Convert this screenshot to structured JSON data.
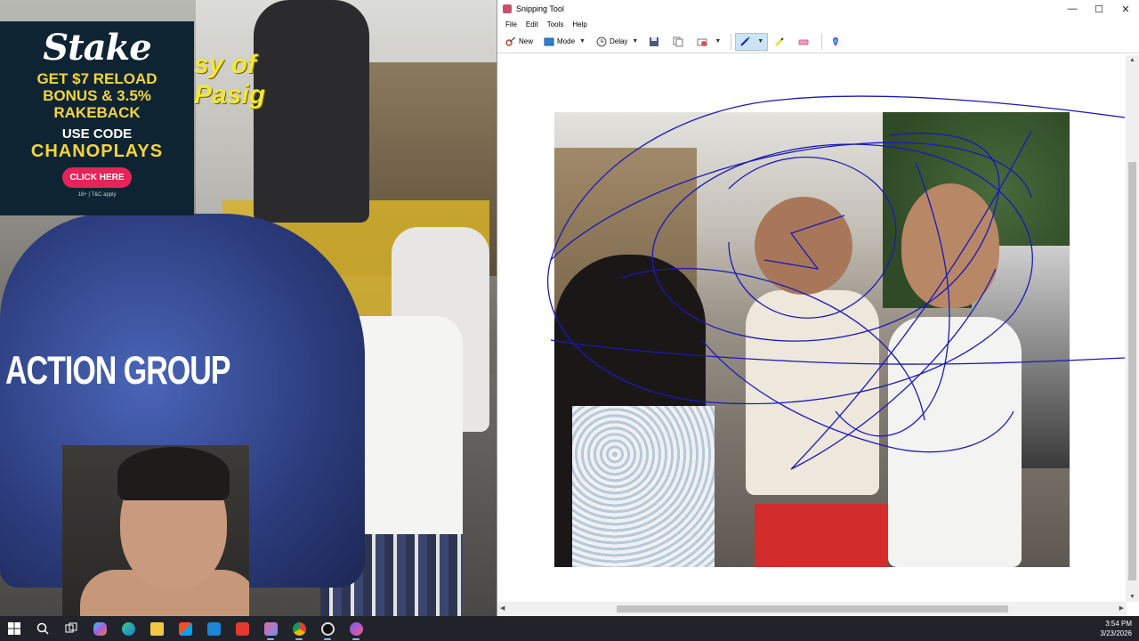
{
  "video": {
    "overlay_text": "sy of\nPasig",
    "jersey_text": "ACTION GROUP"
  },
  "ad": {
    "logo": "Stake",
    "headline": "GET $7 RELOAD BONUS & 3.5% RAKEBACK",
    "use_code": "USE CODE",
    "code": "CHANOPLAYS",
    "button": "CLICK HERE",
    "fine_print": "18+ | T&C apply",
    "accent_color": "#f5d43b",
    "button_color": "#e52459"
  },
  "snipping_tool": {
    "title": "Snipping Tool",
    "window_controls": {
      "minimize": "—",
      "maximize": "☐",
      "close": "✕"
    },
    "menu": [
      "File",
      "Edit",
      "Tools",
      "Help"
    ],
    "toolbar": {
      "new_label": "New",
      "mode_label": "Mode",
      "delay_label": "Delay",
      "pen_color": "#1a1ab8"
    }
  },
  "taskbar": {
    "icons": [
      "windows-start-icon",
      "search-icon",
      "task-view-icon",
      "copilot-icon",
      "edge-icon",
      "file-explorer-icon",
      "store-icon",
      "mail-icon",
      "office-icon",
      "snipping-tool-icon",
      "chrome-icon",
      "obs-icon",
      "app-icon"
    ],
    "time": "3:54 PM",
    "date": "3/23/2026"
  }
}
